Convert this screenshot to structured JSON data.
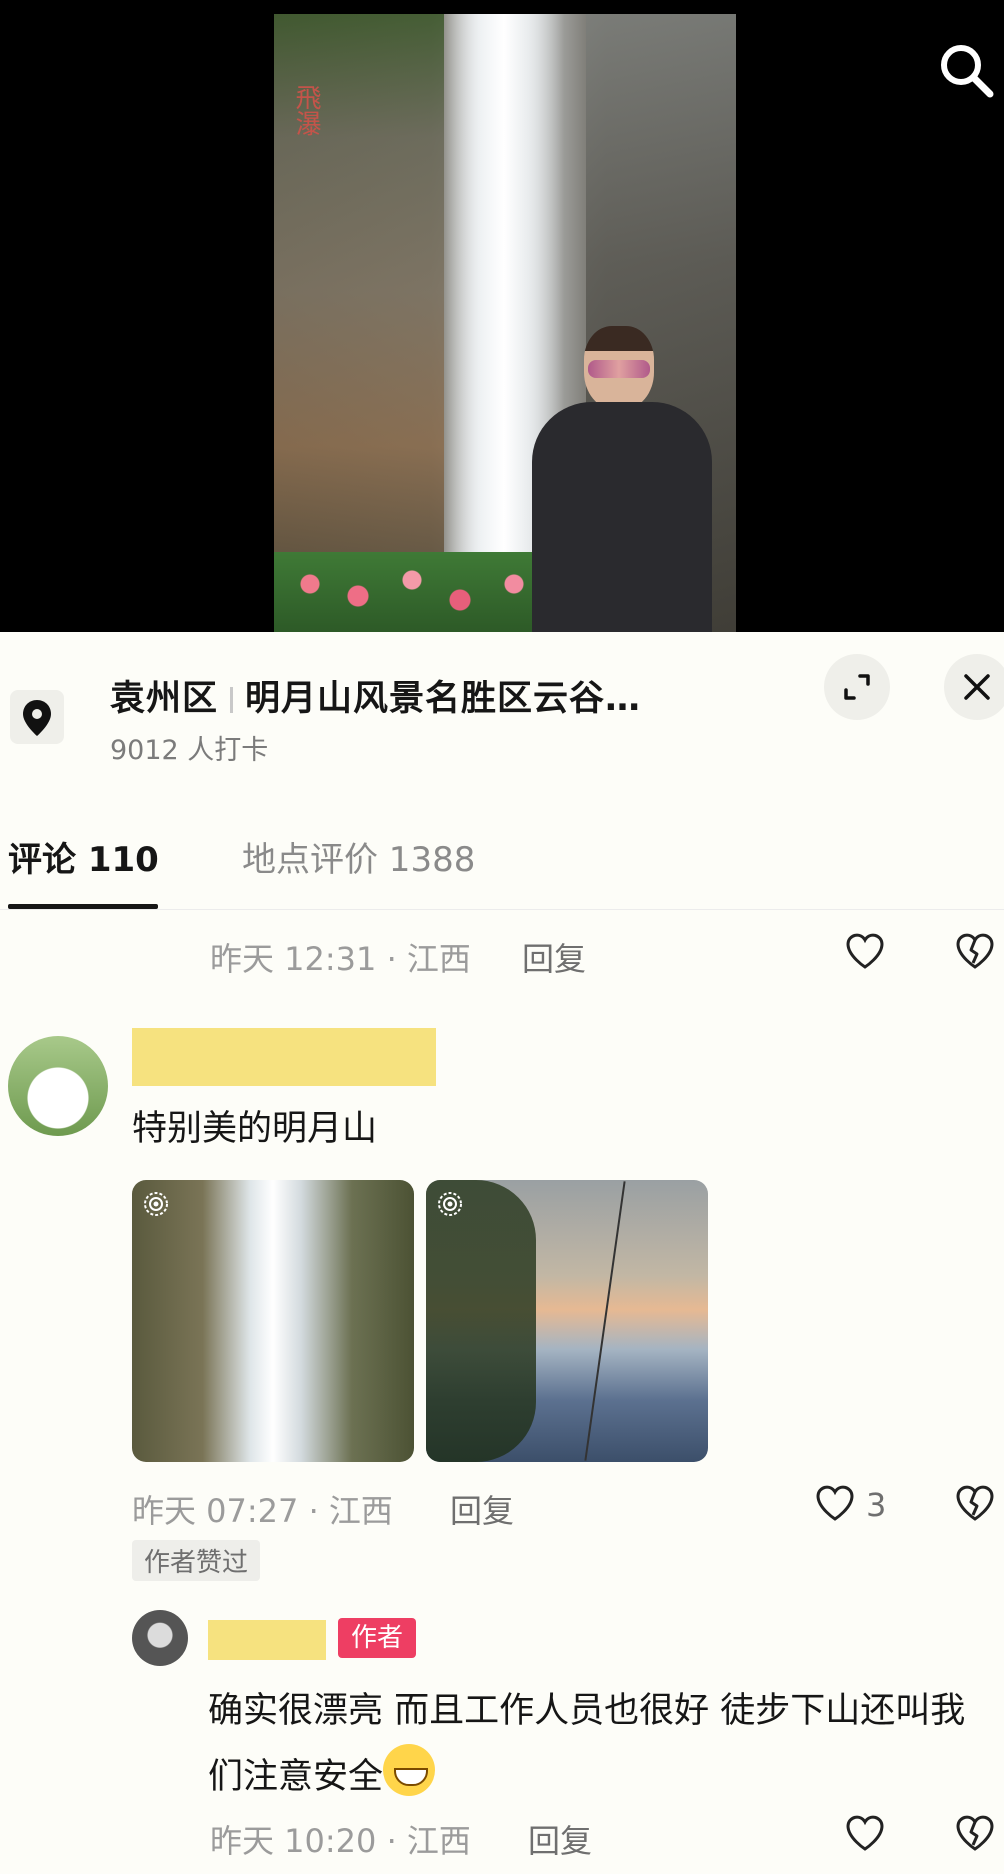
{
  "video": {
    "engraving": "飛瀑"
  },
  "location": {
    "district": "袁州区",
    "name": "明月山风景名胜区云谷…",
    "checkins": "9012 人打卡"
  },
  "tabs": [
    {
      "label": "评论 110",
      "active": true
    },
    {
      "label": "地点评价 1388",
      "active": false
    }
  ],
  "comments": [
    {
      "meta": "昨天 12:31 · 江西",
      "reply_label": "回复"
    },
    {
      "text": "特别美的明月山",
      "photo_count": 2,
      "meta": "昨天 07:27 · 江西",
      "reply_label": "回复",
      "likes": "3",
      "author_liked": "作者赞过"
    },
    {
      "author_tag": "作者",
      "text": "确实很漂亮 而且工作人员也很好 徒步下山还叫我们注意安全",
      "emoji": "grinning-face-icon",
      "meta": "昨天 10:20 · 江西",
      "reply_label": "回复"
    }
  ],
  "colors": {
    "accent_tag": "#ee3e63",
    "name_mask": "#f6e27f",
    "background": "#fdfdf8"
  }
}
